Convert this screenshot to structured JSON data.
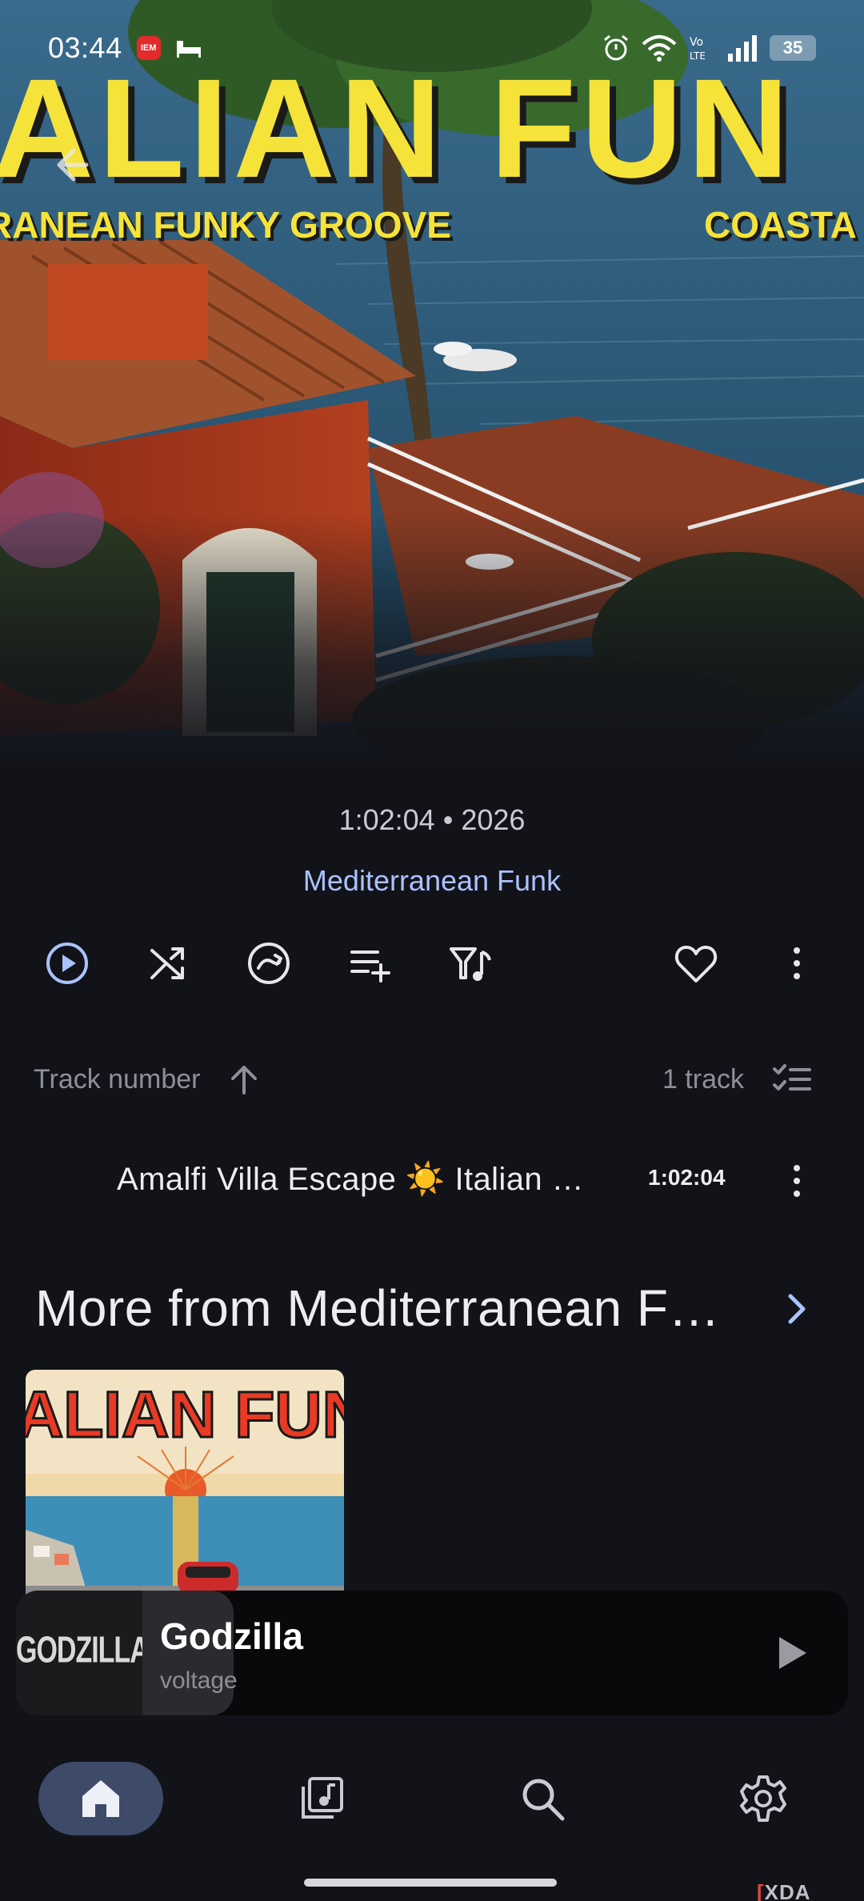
{
  "status_bar": {
    "time": "03:44",
    "badge": "IEM",
    "battery": "35"
  },
  "hero": {
    "title_text": "ALIAN FUN",
    "subtitle_left": "RANEAN FUNKY GROOVE",
    "subtitle_right": "COASTA"
  },
  "album": {
    "duration_year": "1:02:04 • 2026",
    "artist": "Mediterranean Funk"
  },
  "actions": {
    "icons": [
      "play-icon",
      "shuffle-icon",
      "radio-icon",
      "add-to-queue-icon",
      "filter-icon",
      "favorite-icon",
      "more-vert-icon"
    ]
  },
  "track_list": {
    "sort_label": "Track number",
    "count_label": "1 track",
    "tracks": [
      {
        "title": "Amalfi Villa Escape ☀️ Italian …",
        "duration": "1:02:04"
      }
    ]
  },
  "more_from": {
    "title": "More from Mediterranean F…",
    "albums": [
      {
        "art_text": "ALIAN FUN"
      }
    ]
  },
  "mini_player": {
    "art_text": "GODZILLA",
    "title": "Godzilla",
    "artist": "voltage"
  },
  "bottom_nav": {
    "items": [
      "home-icon",
      "library-icon",
      "search-icon",
      "settings-icon"
    ]
  },
  "watermark": {
    "prefix": "[",
    "text": "XDA"
  },
  "colors": {
    "background": "#121319",
    "accent": "#aac2ff",
    "hero_yellow": "#f6e33a",
    "nav_active": "#3d4a68"
  }
}
